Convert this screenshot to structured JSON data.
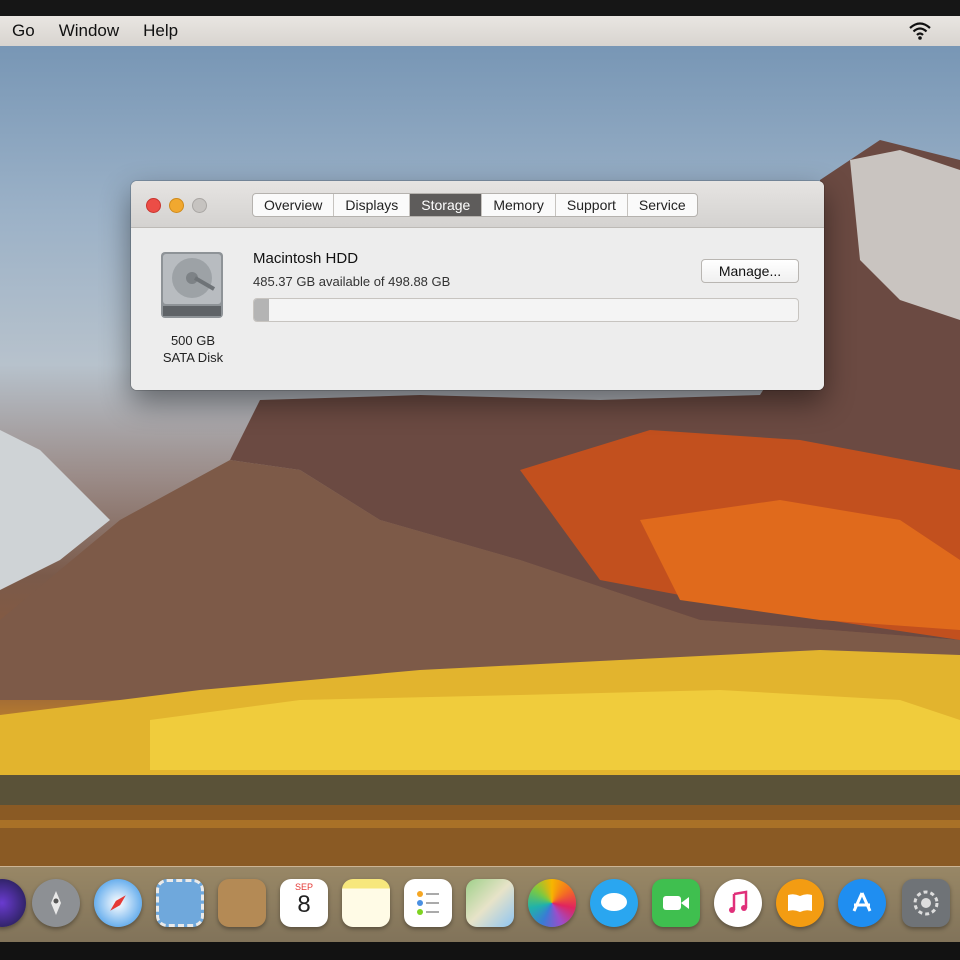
{
  "menubar": {
    "items": [
      "Go",
      "Window",
      "Help"
    ],
    "icons": [
      "wifi-icon"
    ]
  },
  "about_window": {
    "tabs": [
      {
        "label": "Overview",
        "active": false
      },
      {
        "label": "Displays",
        "active": false
      },
      {
        "label": "Storage",
        "active": true
      },
      {
        "label": "Memory",
        "active": false
      },
      {
        "label": "Support",
        "active": false
      },
      {
        "label": "Service",
        "active": false
      }
    ],
    "disk": {
      "size": "500 GB",
      "type": "SATA Disk"
    },
    "volume": {
      "name": "Macintosh HDD",
      "available_text": "485.37 GB available of 498.88 GB",
      "used_fraction": 0.027
    },
    "manage_button": "Manage..."
  },
  "dock": {
    "icons": [
      "siri-icon",
      "launchpad-rocket-icon",
      "safari-compass-icon",
      "mail-stamp-icon",
      "contacts-book-icon",
      "calendar-icon",
      "notes-icon",
      "reminders-icon",
      "maps-icon",
      "photos-icon",
      "messages-icon",
      "facetime-icon",
      "itunes-icon",
      "ibooks-icon",
      "app-store-icon",
      "system-preferences-gear-icon"
    ],
    "calendar_month": "SEP",
    "calendar_day": "8"
  }
}
